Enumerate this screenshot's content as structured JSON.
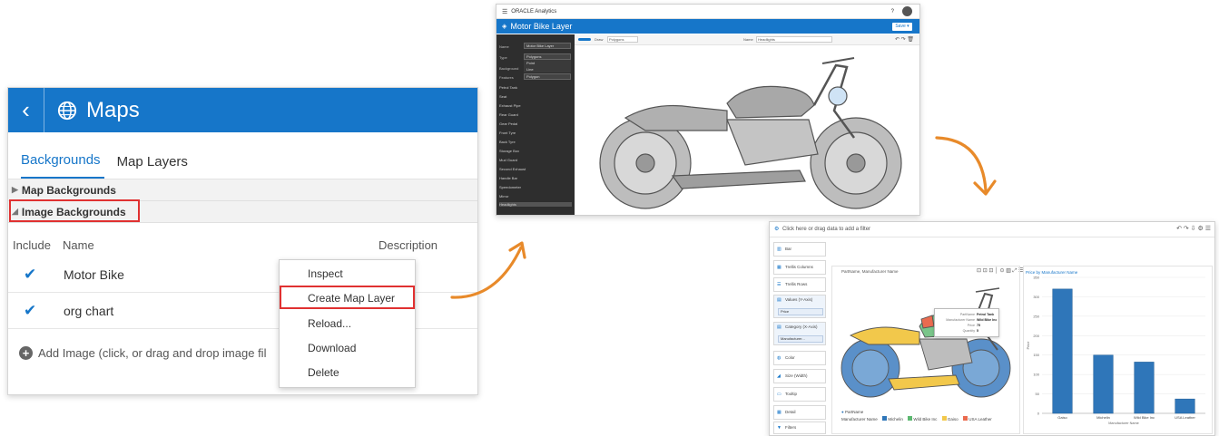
{
  "maps": {
    "title": "Maps",
    "tabs": [
      {
        "label": "Backgrounds",
        "active": true
      },
      {
        "label": "Map Layers",
        "active": false
      }
    ],
    "sections": [
      "Map Backgrounds",
      "Image Backgrounds"
    ],
    "columns": {
      "include": "Include",
      "name": "Name",
      "description": "Description"
    },
    "rows": [
      {
        "name": "Motor Bike",
        "checked": true
      },
      {
        "name": "org chart",
        "checked": true
      }
    ],
    "add_image": "Add Image (click, or drag and drop image fil",
    "context_menu": [
      "Inspect",
      "Create Map Layer",
      "Reload...",
      "Download",
      "Delete"
    ],
    "accent": "#1676c9",
    "highlight": "#e03131"
  },
  "layer": {
    "app": "ORACLE Analytics",
    "title": "Motor Bike Layer",
    "save": "Save",
    "help": "?",
    "fields": {
      "name_label": "Name",
      "name_value": "Motor Bike Layer",
      "type_label": "Type",
      "type_value": "Polygons",
      "background_label": "Background",
      "features_label": "Features",
      "features_value": "Polygon"
    },
    "type_options": [
      "Point",
      "Line"
    ],
    "toolbar": {
      "draw_label": "Draw",
      "draw_value": "Polygons",
      "name_label": "Name",
      "name_value": "Headlights"
    },
    "features": [
      "Petrol Tank",
      "Seat",
      "Exhaust Pipe",
      "Rear Guard",
      "Gear Pedal",
      "Front Tyre",
      "Back Tyre",
      "Storage Box",
      "Mud Guard",
      "Second Exhaust",
      "Handle Bar",
      "Speedometer",
      "Mirror",
      "Headlights"
    ]
  },
  "dash": {
    "filter_hint": "Click here or drag data to add a filter",
    "grammar": [
      {
        "label": "Bar",
        "icon": "bar-chart-icon"
      },
      {
        "label": "Trellis Columns"
      },
      {
        "label": "Trellis Rows"
      },
      {
        "label": "Values (Y-Axis)",
        "pill": "Price"
      },
      {
        "label": "Category (X-Axis)",
        "pill": "Manufacturer..."
      },
      {
        "label": "Color"
      },
      {
        "label": "Size (Width)"
      },
      {
        "label": "Tooltip"
      },
      {
        "label": "Detail"
      },
      {
        "label": "Filters"
      }
    ],
    "viz1_title": "PartName, Manufacturer Name",
    "tooltip": {
      "rows": [
        [
          "PartName",
          "Petrol Tank"
        ],
        [
          "Manufacturer Name",
          "Wild Bike Inc"
        ],
        [
          "Price",
          "75"
        ],
        [
          "Quantity",
          "5"
        ]
      ]
    },
    "legend": {
      "title": "PartName",
      "subtitle": "Manufacturer Name",
      "items": [
        {
          "label": "Michelin",
          "color": "#2f76b9"
        },
        {
          "label": "Wild Bike Inc",
          "color": "#5cb870"
        },
        {
          "label": "Gaiso",
          "color": "#f2c84b"
        },
        {
          "label": "USA Leather",
          "color": "#ea6b4f"
        }
      ]
    },
    "viz2_title": "Price by Manufacturer Name"
  },
  "chart_data": {
    "type": "bar",
    "title": "Price by Manufacturer Name",
    "categories": [
      "Gaiso",
      "Michelin",
      "Wild Bike Inc",
      "USA Leather"
    ],
    "values": [
      320,
      150,
      132,
      37
    ],
    "ylim": [
      0,
      350
    ],
    "yticks": [
      0,
      50,
      100,
      150,
      200,
      250,
      300,
      350
    ],
    "xlabel": "Manufacturer Name",
    "ylabel": "Price",
    "color": "#2f76b9"
  }
}
